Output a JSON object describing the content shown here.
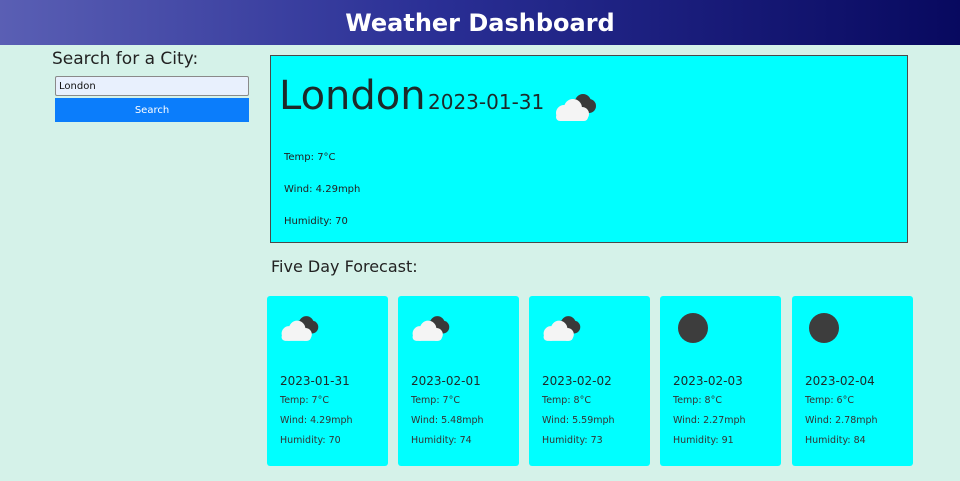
{
  "header": {
    "title": "Weather Dashboard"
  },
  "search": {
    "heading": "Search for a City:",
    "input_value": "London",
    "button_label": "Search"
  },
  "current": {
    "city": "London",
    "date": "2023-01-31",
    "icon": "cloudy-icon",
    "temp": "Temp: 7°C",
    "wind": "Wind: 4.29mph",
    "humidity": "Humidity: 70"
  },
  "forecast": {
    "title": "Five Day Forecast:",
    "days": [
      {
        "date": "2023-01-31",
        "icon": "cloudy-icon",
        "temp": "Temp: 7°C",
        "wind": "Wind: 4.29mph",
        "humidity": "Humidity: 70"
      },
      {
        "date": "2023-02-01",
        "icon": "cloudy-icon",
        "temp": "Temp: 7°C",
        "wind": "Wind: 5.48mph",
        "humidity": "Humidity: 74"
      },
      {
        "date": "2023-02-02",
        "icon": "cloudy-icon",
        "temp": "Temp: 8°C",
        "wind": "Wind: 5.59mph",
        "humidity": "Humidity: 73"
      },
      {
        "date": "2023-02-03",
        "icon": "dark-circle-icon",
        "temp": "Temp: 8°C",
        "wind": "Wind: 2.27mph",
        "humidity": "Humidity: 91"
      },
      {
        "date": "2023-02-04",
        "icon": "dark-circle-icon",
        "temp": "Temp: 6°C",
        "wind": "Wind: 2.78mph",
        "humidity": "Humidity: 84"
      }
    ]
  },
  "colors": {
    "background": "#d5f2e9",
    "panel": "#00ffff",
    "button": "#0b7dfb",
    "header_start": "#5a5fb4",
    "header_end": "#08095f"
  }
}
